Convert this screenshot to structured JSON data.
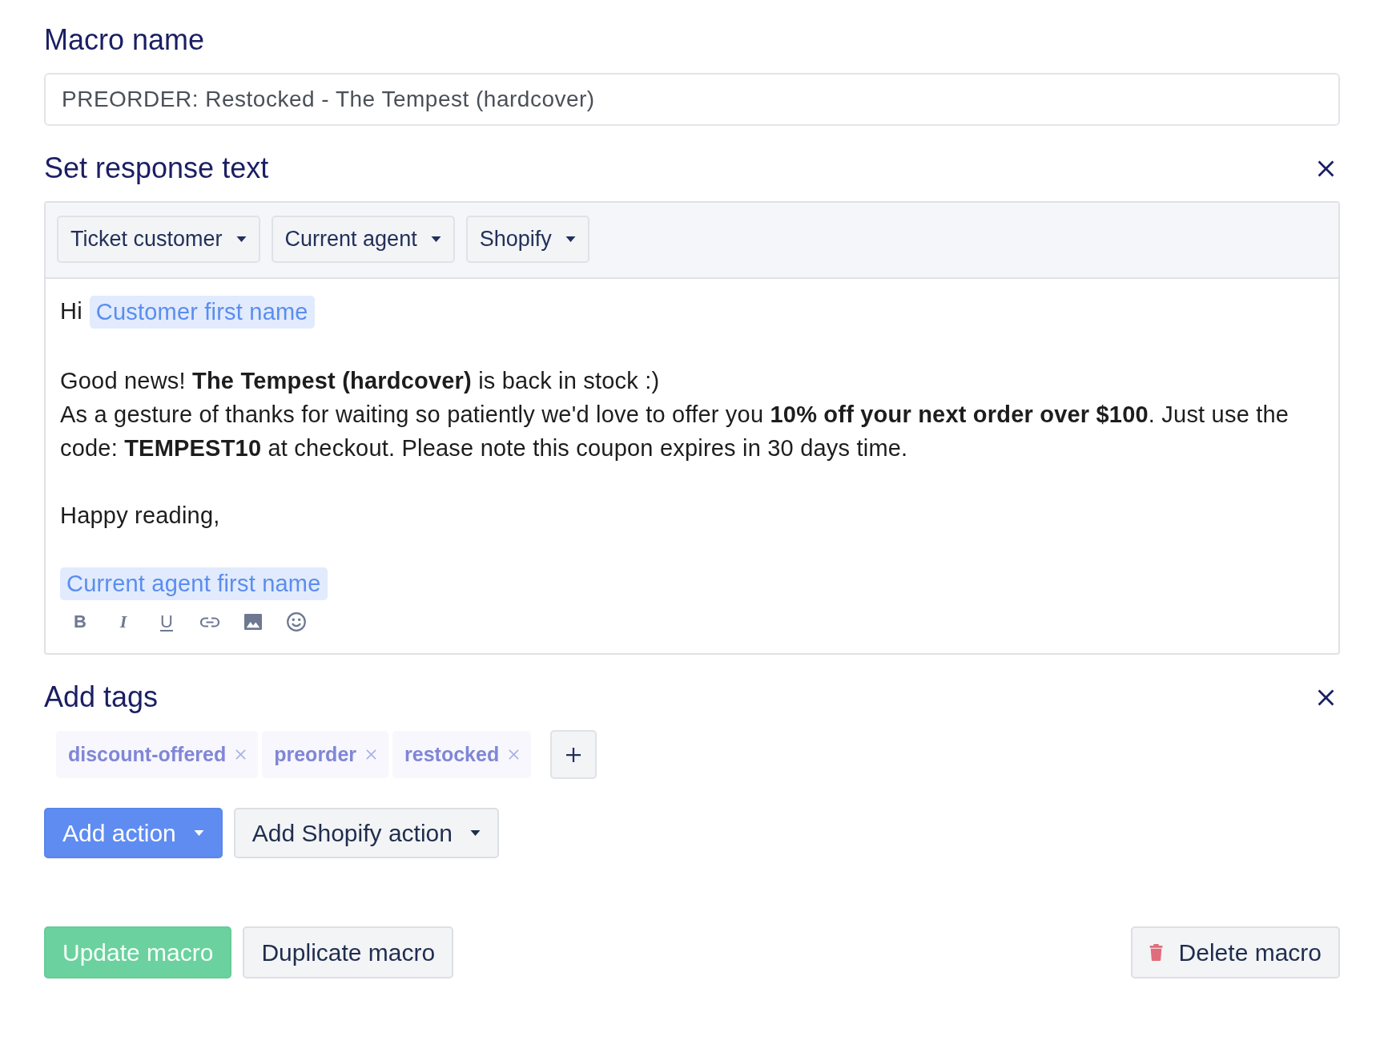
{
  "macro_name": {
    "label": "Macro name",
    "value": "PREORDER: Restocked - The Tempest (hardcover)"
  },
  "response_text": {
    "title": "Set response text",
    "removable": true,
    "variable_menus": [
      {
        "label": "Ticket customer"
      },
      {
        "label": "Current agent"
      },
      {
        "label": "Shopify"
      }
    ],
    "paragraphs": [
      {
        "lines": [
          {
            "parts": [
              {
                "kind": "text",
                "text": "Hi"
              },
              {
                "kind": "variable",
                "text": "Customer first name"
              }
            ]
          }
        ]
      },
      {
        "lines": [
          {
            "parts": [
              {
                "kind": "text",
                "text": "Good news! **The Tempest (hardcover)** is back in stock :)"
              }
            ]
          },
          {
            "parts": [
              {
                "kind": "text",
                "text": "As a gesture of thanks for waiting so patiently we'd love to offer you **10% off your next order over $100**. Just use the code: **TEMPEST10** at checkout. Please note this coupon expires in 30 days time."
              }
            ]
          }
        ]
      },
      {
        "lines": [
          {
            "parts": [
              {
                "kind": "text",
                "text": "Happy reading,"
              }
            ]
          }
        ]
      },
      {
        "lines": [
          {
            "parts": [
              {
                "kind": "variable",
                "text": "Current agent first name"
              }
            ]
          }
        ]
      }
    ],
    "format_tools": [
      {
        "kind": "bold",
        "glyph": "B"
      },
      {
        "kind": "italic",
        "glyph": "I"
      },
      {
        "kind": "underline",
        "glyph": "U"
      },
      {
        "kind": "link"
      },
      {
        "kind": "image"
      },
      {
        "kind": "emoji"
      }
    ]
  },
  "tags": {
    "title": "Add tags",
    "removable": true,
    "items": [
      {
        "label": "discount-offered"
      },
      {
        "label": "preorder"
      },
      {
        "label": "restocked"
      }
    ]
  },
  "actions": [
    {
      "label": "Add action",
      "kind": "primary",
      "menu": true
    },
    {
      "label": "Add Shopify action",
      "kind": "secondary",
      "menu": true
    }
  ],
  "footer": {
    "left": [
      {
        "label": "Update macro",
        "kind": "success"
      },
      {
        "label": "Duplicate macro",
        "kind": "secondary"
      }
    ],
    "right": [
      {
        "label": "Delete macro",
        "kind": "danger"
      }
    ]
  }
}
